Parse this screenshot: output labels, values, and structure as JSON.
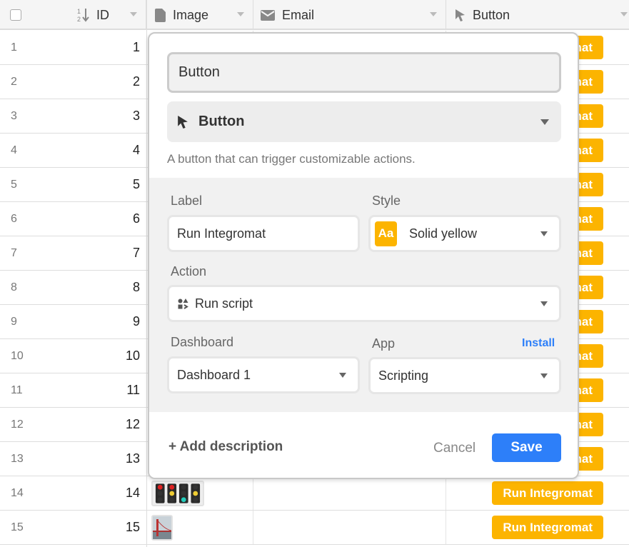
{
  "grid": {
    "columns": [
      {
        "label": "ID",
        "icon": "sort-numeric-icon"
      },
      {
        "label": "Image",
        "icon": "file-icon"
      },
      {
        "label": "Email",
        "icon": "envelope-icon"
      },
      {
        "label": "Button",
        "icon": "cursor-icon"
      }
    ],
    "rows": [
      {
        "num": "1",
        "id": "1",
        "button": "Run Integromat"
      },
      {
        "num": "2",
        "id": "2",
        "button": "Run Integromat"
      },
      {
        "num": "3",
        "id": "3",
        "button": "Run Integromat"
      },
      {
        "num": "4",
        "id": "4",
        "button": "Run Integromat"
      },
      {
        "num": "5",
        "id": "5",
        "button": "Run Integromat"
      },
      {
        "num": "6",
        "id": "6",
        "button": "Run Integromat"
      },
      {
        "num": "7",
        "id": "7",
        "button": "Run Integromat"
      },
      {
        "num": "8",
        "id": "8",
        "button": "Run Integromat"
      },
      {
        "num": "9",
        "id": "9",
        "button": "Run Integromat"
      },
      {
        "num": "10",
        "id": "10",
        "button": "Run Integromat"
      },
      {
        "num": "11",
        "id": "11",
        "button": "Run Integromat"
      },
      {
        "num": "12",
        "id": "12",
        "button": "Run Integromat"
      },
      {
        "num": "13",
        "id": "13",
        "button": "Run Integromat"
      },
      {
        "num": "14",
        "id": "14",
        "button": "Run Integromat",
        "image": "traffic-lights-thumbnail"
      },
      {
        "num": "15",
        "id": "15",
        "button": "Run Integromat",
        "image": "bridge-thumbnail"
      }
    ]
  },
  "modal": {
    "field_name": "Button",
    "field_type": "Button",
    "description": "A button that can trigger customizable actions.",
    "label_label": "Label",
    "label_value": "Run Integromat",
    "style_label": "Style",
    "style_value": "Solid yellow",
    "style_swatch": "Aa",
    "action_label": "Action",
    "action_value": "Run script",
    "dashboard_label": "Dashboard",
    "dashboard_value": "Dashboard 1",
    "app_label": "App",
    "app_install": "Install",
    "app_value": "Scripting",
    "add_description": "+ Add description",
    "cancel": "Cancel",
    "save": "Save"
  },
  "colors": {
    "button_yellow": "#fcb400",
    "primary_blue": "#2d7ff9"
  }
}
